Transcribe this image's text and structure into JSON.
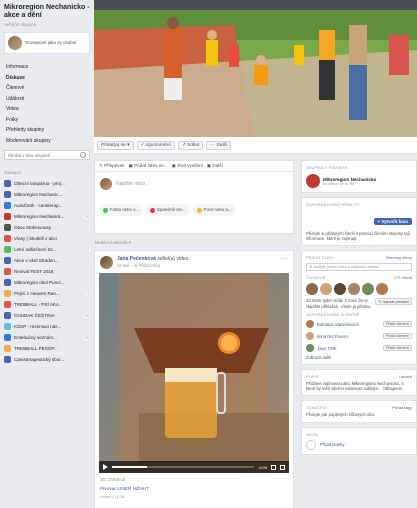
{
  "group": {
    "title": "Mikroregion Nechanicko - akce a dění",
    "privacy": "Veřejná skupina",
    "join_text": "Rozepsání jako sy osobní"
  },
  "nav": [
    "Informace",
    "Diskuze",
    "Členové",
    "Události",
    "Videa",
    "Fotky",
    "Přehledy skupiny",
    "Moderování skupiny"
  ],
  "nav_active_index": 1,
  "search": {
    "placeholder": "Hledat v této skupině"
  },
  "shortcuts": {
    "heading": "Zástupci",
    "items": [
      {
        "label": "Obecní lampárna - proj...",
        "color": "#4267b2",
        "badge": ""
      },
      {
        "label": "Mikroregion Nechanic...",
        "color": "#4267b2",
        "badge": ""
      },
      {
        "label": "AuraČank - cankterap...",
        "color": "#3578e5",
        "badge": ""
      },
      {
        "label": "Mikroregion Nechanick...",
        "color": "#c0392b",
        "badge": "20"
      },
      {
        "label": "Obec Mokrovousy",
        "color": "#555555",
        "badge": "1"
      },
      {
        "label": "Vlasy | Skutkiš v akci",
        "color": "#d9534f",
        "badge": ""
      },
      {
        "label": "Letní odšečnení tis...",
        "color": "#5cb85c",
        "badge": "2"
      },
      {
        "label": "Akce v okol Straden...",
        "color": "#4267b2",
        "badge": "8"
      },
      {
        "label": "Revival FEST 2018",
        "color": "#d9534f",
        "badge": ""
      },
      {
        "label": "Mikroregion okol Puncl...",
        "color": "#4267b2",
        "badge": ""
      },
      {
        "label": "Pejzú z Heaven Ran...",
        "color": "#f0ad4e",
        "badge": "4"
      },
      {
        "label": "TREBBALL - PSÍ AKA...",
        "color": "#d9534f",
        "badge": ""
      },
      {
        "label": "CHUDAK ČEŠTINA",
        "color": "#4267b2",
        "badge": "20"
      },
      {
        "label": "KŠSP - rezervaci nás...",
        "color": "#5bc0de",
        "badge": ""
      },
      {
        "label": "Entebučný seznám...",
        "color": "#3578e5",
        "badge": "20"
      },
      {
        "label": "TREBBALL PESOP...",
        "color": "#f0ad4e",
        "badge": "2"
      },
      {
        "label": "Canisterapeutický sbor...",
        "color": "#4267b2",
        "badge": ""
      }
    ]
  },
  "actions": [
    "Přidat(a) se ▾",
    "✓ Upozornění",
    "↗ Sdílet",
    "··· Další"
  ],
  "composer": {
    "tabs": [
      "✎ Příspěvek",
      "▣ Přidat fotku ne...",
      "▣ Živé vysílání",
      "▣ Další"
    ],
    "placeholder": "Napište něco...",
    "chips": [
      {
        "label": "Fotka nebo v...",
        "color": "#45bd62"
      },
      {
        "label": "Společně sle...",
        "color": "#f02849"
      },
      {
        "label": "Pocit nebo a...",
        "color": "#f7b928"
      }
    ]
  },
  "activity_heading": "Nedávná aktivita ▾",
  "post": {
    "author": "Jana Pečenková",
    "action": "sdílel(a) video.",
    "meta": "16 kvě. · ⊕ Přidat zdroj",
    "views": "357 zhlédnutí",
    "next_title": "Pivovar LINER MŽAHT",
    "next_meta": "Včera v 11:18",
    "video_time": "-0:09",
    "progress": 0.25
  },
  "right": {
    "group_card": {
      "heading": "Skupina v původní",
      "name": "Mikroregion Nechanicko",
      "sub": "60 dnech se to líbí"
    },
    "invite_card": {
      "heading": "Doporučování přidejte",
      "button": "+ Vytvořit fanu",
      "text": "Přidejte si přidaných členů s pomocí členům skupiny tají informace, které je zajímají."
    },
    "members_card": {
      "heading": "Přidat členy",
      "link": "Všechny členy",
      "search": "⊕ Zadejte jméno nebo e-mailovou adresu",
      "count_label": "Členové",
      "count": "271 členů",
      "text": "Za tento týden máte 3 nové členy. Napište přihlašek, vítejte je přivítat.",
      "welcome_button": "✎ Napsat přivítání",
      "suggest_heading": "Doporučování členové",
      "members": [
        {
          "name": "Bohdana Stanislavová",
          "color": "#b07a50",
          "button": "Přidat členem"
        },
        {
          "name": "Ilona Del Favero",
          "color": "#c9a37a",
          "button": "Přidat členem"
        },
        {
          "name": "Jaan Töök",
          "color": "#6e8b5a",
          "button": "Přidat členem"
        }
      ],
      "more": "Zobrazit další"
    },
    "info_card": {
      "heading": "Popis",
      "link": "Upravit",
      "text": "Přidáme zajímavou akci Mikroregionu Nechanicko, a které by měli všichni vstatovat! Sdílejte... Obhajeme."
    },
    "label_card": {
      "heading": "Označení",
      "link": "Přidat tagy",
      "text": "Přidejte pár popisných klíčových slov."
    },
    "location_card": {
      "heading": "Místa",
      "label": "Přidat polohy"
    }
  }
}
